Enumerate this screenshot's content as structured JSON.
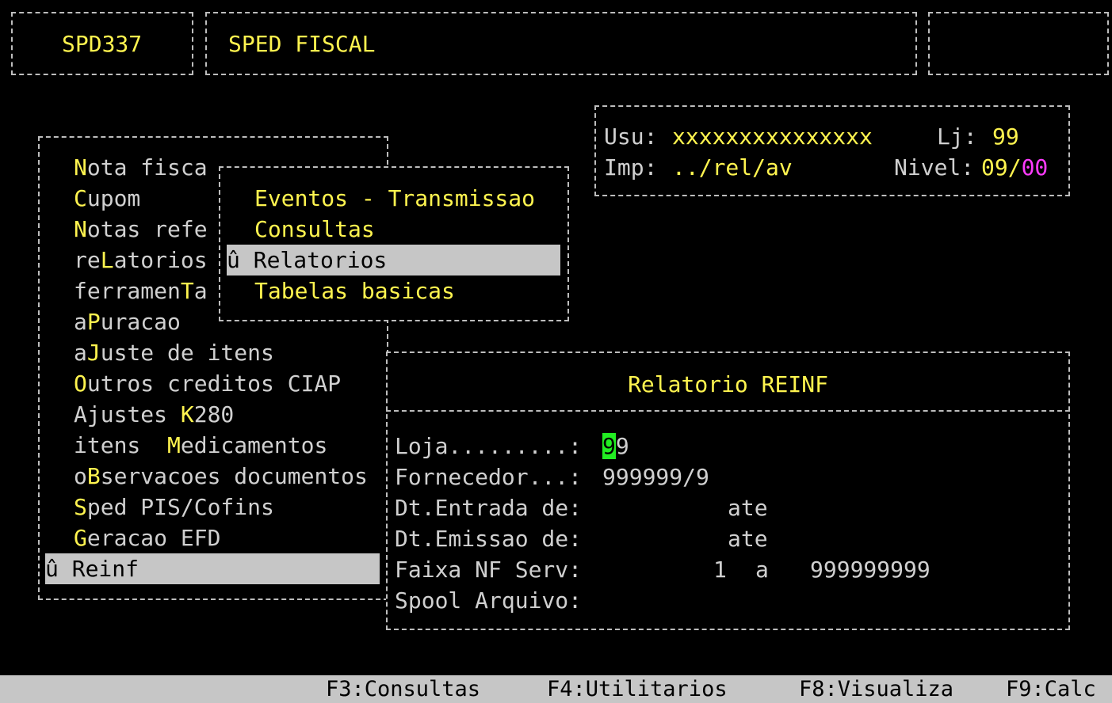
{
  "header": {
    "program_code": "SPD337",
    "system_title": "SPED FISCAL",
    "right_box": ""
  },
  "info_panel": {
    "user_label": "Usu:",
    "user_value": "xxxxxxxxxxxxxxx",
    "store_label": "Lj:",
    "store_value": "99",
    "printer_label": "Imp:",
    "printer_value": "../rel/av",
    "level_label": "Nivel:",
    "level_value_a": "09/",
    "level_value_b": "00"
  },
  "main_menu": {
    "items": [
      {
        "prefix": "",
        "hot": "N",
        "rest": "ota fisca"
      },
      {
        "prefix": "",
        "hot": "C",
        "rest": "upom"
      },
      {
        "prefix": "",
        "hot": "N",
        "rest": "otas refe"
      },
      {
        "prefix": "re",
        "hot": "L",
        "rest": "atorios"
      },
      {
        "prefix": "ferramen",
        "hot": "T",
        "rest": "a"
      },
      {
        "prefix": "a",
        "hot": "P",
        "rest": "uracao"
      },
      {
        "prefix": "a",
        "hot": "J",
        "rest": "uste de itens"
      },
      {
        "prefix": "",
        "hot": "O",
        "rest": "utros creditos CIAP"
      },
      {
        "prefix": "Ajustes ",
        "hot": "K",
        "rest": "280"
      },
      {
        "prefix": "itens  ",
        "hot": "M",
        "rest": "edicamentos"
      },
      {
        "prefix": "o",
        "hot": "B",
        "rest": "servacoes documentos"
      },
      {
        "prefix": "",
        "hot": "S",
        "rest": "ped PIS/Cofins"
      },
      {
        "prefix": "",
        "hot": "G",
        "rest": "eracao EFD"
      }
    ],
    "selected_item": "û Reinf"
  },
  "submenu": {
    "items": [
      "Eventos - Transmissao",
      "Consultas"
    ],
    "selected_item": "û Relatorios",
    "last_item": "Tabelas basicas"
  },
  "report_dialog": {
    "title": "Relatorio REINF",
    "loja_label": "Loja.........:",
    "loja_cursor": "9",
    "loja_rest": "9",
    "fornecedor_label": "Fornecedor...:",
    "fornecedor_value": "999999/9",
    "dt_entrada_label": "Dt.Entrada de:",
    "dt_entrada_ate": "ate",
    "dt_emissao_label": "Dt.Emissao de:",
    "dt_emissao_ate": "ate",
    "faixa_label": "Faixa NF Serv:",
    "faixa_from": "1",
    "faixa_sep": "a",
    "faixa_to": "999999999",
    "spool_label": "Spool Arquivo:"
  },
  "function_keys": {
    "f3": "F3:Consultas",
    "f4": "F4:Utilitarios",
    "f8": "F8:Visualiza",
    "f9": "F9:Calc"
  }
}
